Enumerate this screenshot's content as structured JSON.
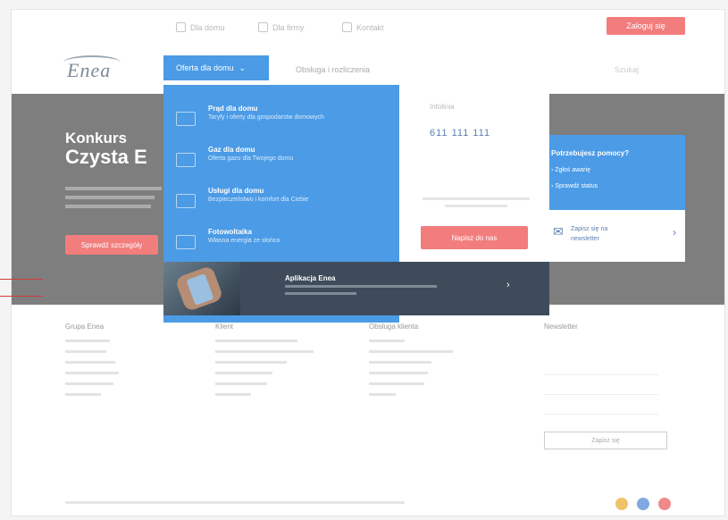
{
  "topbar": {
    "util_items": [
      "Dla domu",
      "Dla firmy",
      "Kontakt"
    ],
    "login_label": "Zaloguj się"
  },
  "nav": {
    "logo_text": "Enea",
    "tab_active": "Oferta dla domu",
    "tab_second": "Obsługa i rozliczenia",
    "search_placeholder": "Szukaj"
  },
  "hero": {
    "title_line1": "Konkurs",
    "title_line2": "Czysta E",
    "button_label": "Sprawdź szczegóły"
  },
  "dropdown": {
    "items": [
      {
        "title": "Prąd dla domu",
        "subtitle": "Taryfy i oferty dla gospodarstw domowych"
      },
      {
        "title": "Gaz dla domu",
        "subtitle": "Oferta gazu dla Twojego domu"
      },
      {
        "title": "Usługi dla domu",
        "subtitle": "Bezpieczeństwo i komfort dla Ciebie"
      },
      {
        "title": "Fotowoltaika",
        "subtitle": "Własna energia ze słońca"
      }
    ]
  },
  "white_panel": {
    "title": "Infolinia",
    "phone": "611 111 111",
    "button_label": "Napisz do nas"
  },
  "side_blue": {
    "question": "Potrzebujesz pomocy?",
    "links": [
      "Zgłoś awarię",
      "Sprawdź status"
    ]
  },
  "side_white": {
    "text_line1": "Zapisz się na",
    "text_line2": "newsletter"
  },
  "banner": {
    "title": "Aplikacja Enea"
  },
  "footer": {
    "col1_heading": "Grupa Enea",
    "col2_heading": "Klient",
    "col3_heading": "Obsługa klienta",
    "col4_heading": "Newsletter",
    "newsletter_button": "Zapisz się"
  },
  "colors": {
    "accent_blue": "#4b9be6",
    "cta_red": "#f27d7d",
    "dark_banner": "#3f4b5a"
  }
}
